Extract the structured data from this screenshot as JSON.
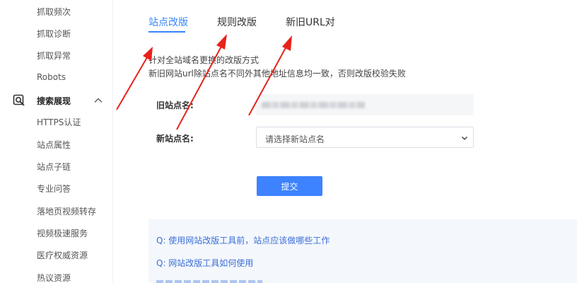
{
  "sidebar": {
    "items_top": [
      {
        "label": "抓取频次"
      },
      {
        "label": "抓取诊断"
      },
      {
        "label": "抓取异常"
      },
      {
        "label": "Robots"
      }
    ],
    "group": {
      "label": "搜索展现",
      "icon": "search-view-icon",
      "expanded": true
    },
    "items_group": [
      {
        "label": "HTTPS认证"
      },
      {
        "label": "站点属性"
      },
      {
        "label": "站点子链"
      },
      {
        "label": "专业问答"
      },
      {
        "label": "落地页视频转存"
      },
      {
        "label": "视频极速服务"
      },
      {
        "label": "医疗权威资源"
      },
      {
        "label": "热议资源"
      }
    ]
  },
  "tabs": [
    {
      "label": "站点改版",
      "active": true
    },
    {
      "label": "规则改版",
      "active": false
    },
    {
      "label": "新旧URL对",
      "active": false
    }
  ],
  "description": {
    "line1": "针对全站域名更换的改版方式",
    "line2": "新旧网站url除站点名不同外其他地址信息均一致，否则改版校验失败"
  },
  "form": {
    "old_site_label": "旧站点名:",
    "new_site_label": "新站点名:",
    "new_site_placeholder": "请选择新站点名",
    "submit_label": "提交"
  },
  "faq": [
    {
      "text": "Q:  使用网站改版工具前，站点应该做哪些工作"
    },
    {
      "text": "Q:  网站改版工具如何使用"
    }
  ],
  "colors": {
    "accent": "#3385ff",
    "button": "#3d82ff",
    "annotation_arrow": "#e8221b",
    "faq_bg": "#f4f7fc"
  }
}
